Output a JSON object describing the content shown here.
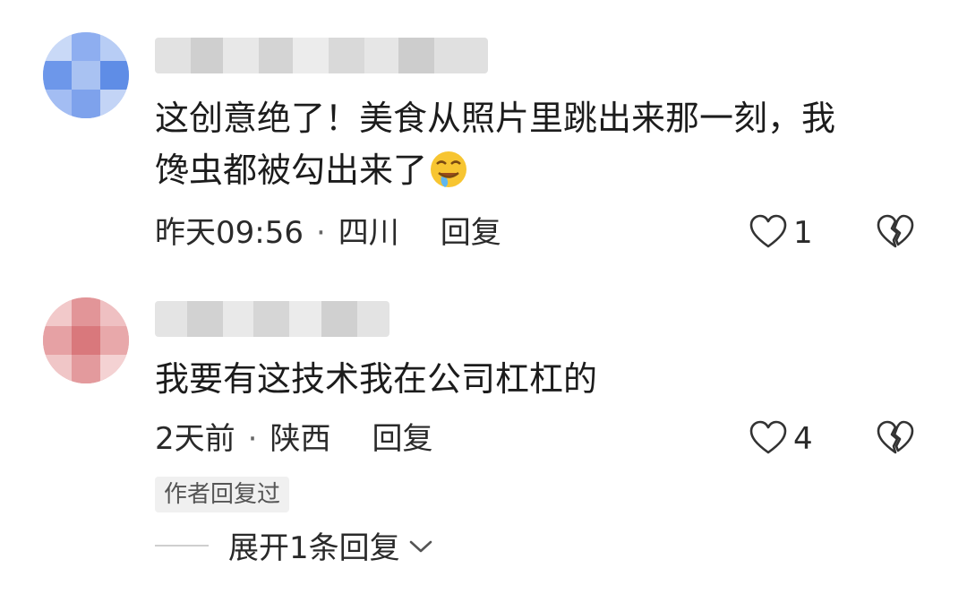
{
  "comments": [
    {
      "username": "",
      "text_line1": "这创意绝了！美食从照片里跳出来那一刻，我",
      "text_line2": "馋虫都被勾出来了",
      "emoji": "drooling-face",
      "time": "昨天09:56",
      "location": "四川",
      "reply_label": "回复",
      "like_count": "1"
    },
    {
      "username": "",
      "text_line1": "我要有这技术我在公司杠杠的",
      "time": "2天前",
      "location": "陕西",
      "reply_label": "回复",
      "like_count": "4",
      "author_badge": "作者回复过",
      "expand_label": "展开1条回复"
    }
  ],
  "separator": "·",
  "colors": {
    "text": "#1c1c1c",
    "muted": "#2a2a2a",
    "badge_bg": "#f0f0f0"
  }
}
